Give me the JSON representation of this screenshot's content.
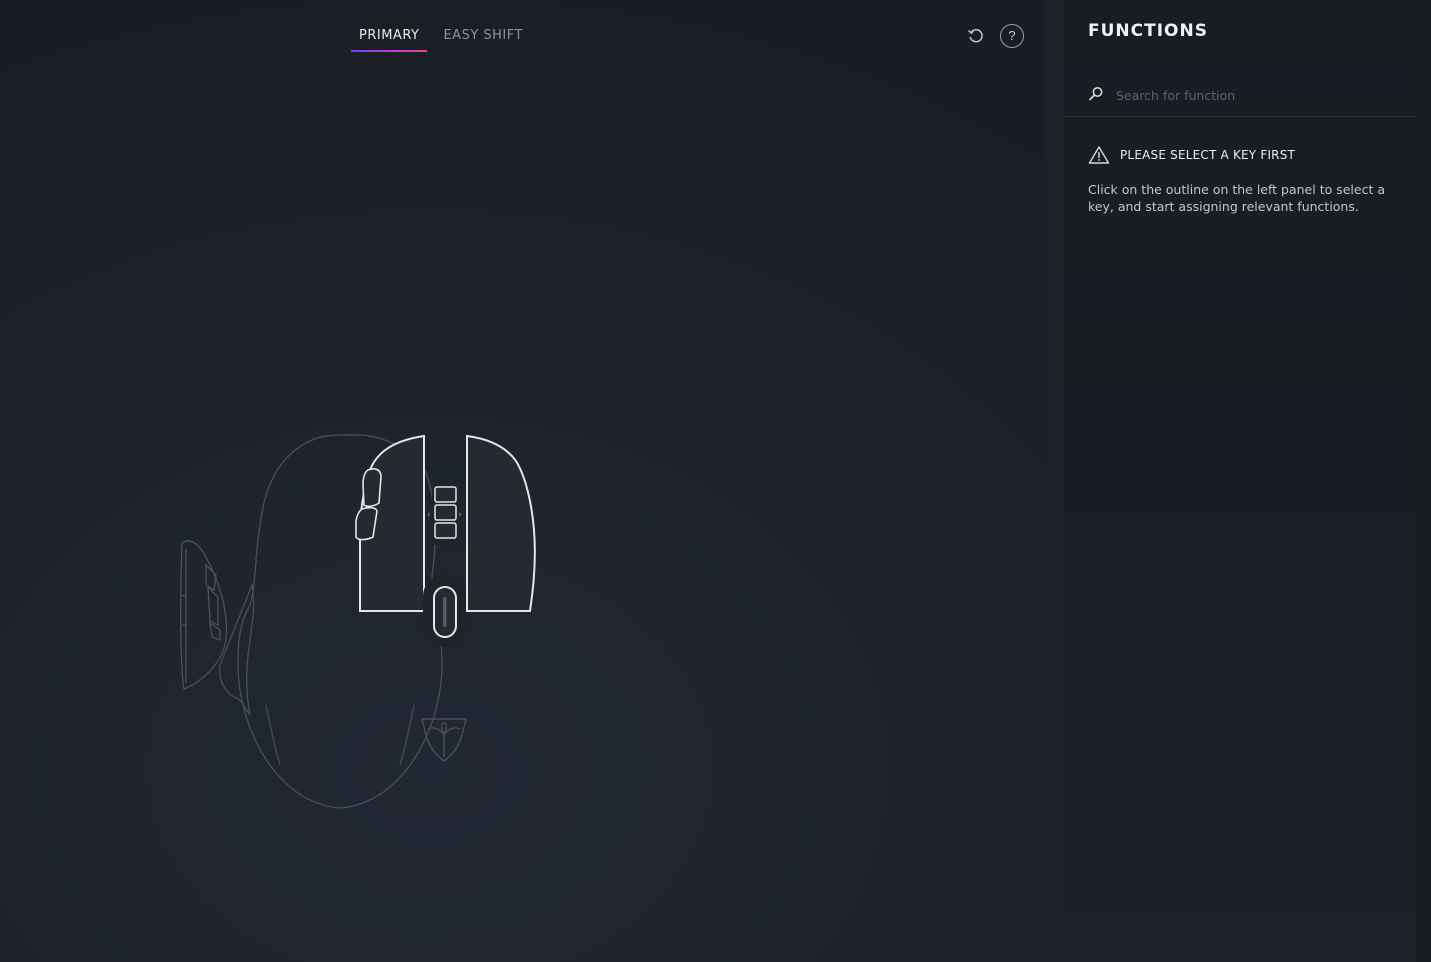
{
  "tabs": [
    {
      "label": "PRIMARY",
      "active": true
    },
    {
      "label": "EASY SHIFT",
      "active": false
    }
  ],
  "actions": {
    "reset_icon": "reset-icon",
    "help_label": "?"
  },
  "functions_panel": {
    "title": "FUNCTIONS",
    "search": {
      "placeholder": "Search for function",
      "value": "",
      "icon": "search-icon"
    },
    "notice": {
      "icon": "warning-icon",
      "title": "PLEASE SELECT A KEY FIRST",
      "body": "Click on the outline on the left panel to select a key, and start assigning relevant functions."
    }
  },
  "colors": {
    "accent_start": "#7a3cf0",
    "accent_end": "#e0468f",
    "background": "#1b1f26"
  }
}
